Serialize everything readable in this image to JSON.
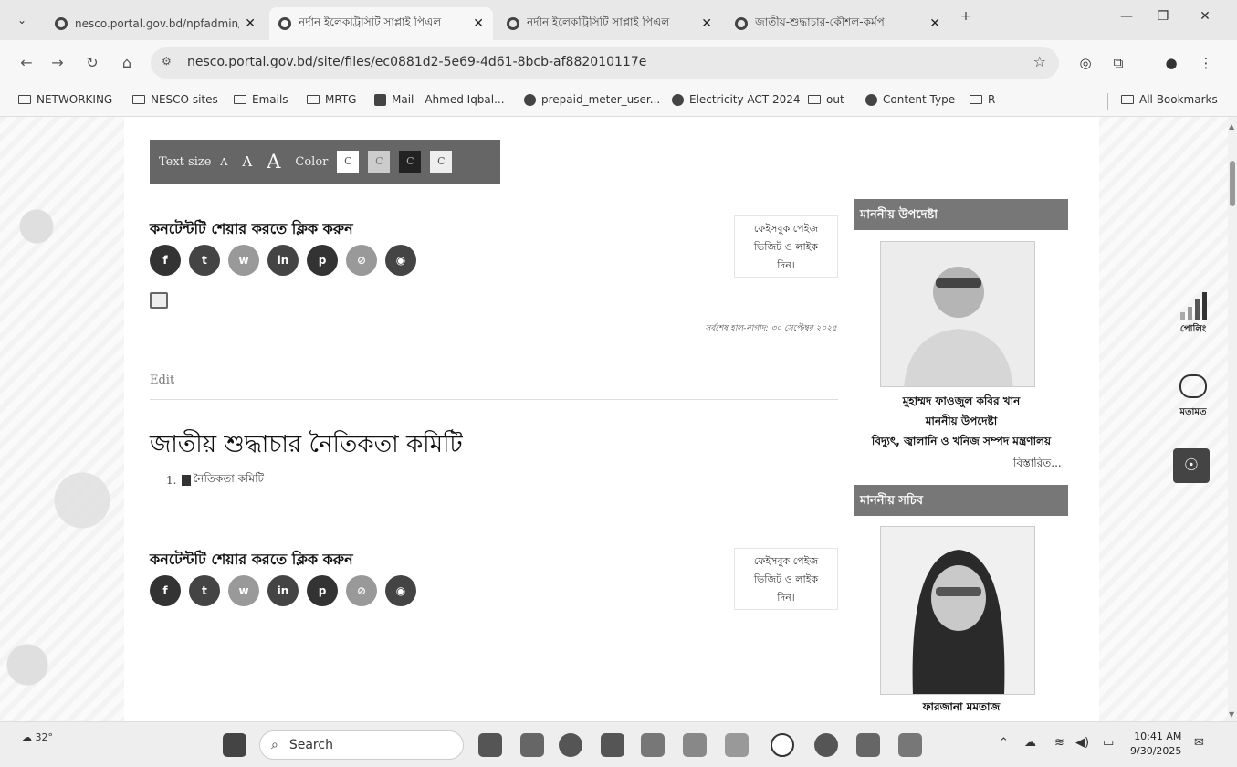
{
  "browser": {
    "tabs": [
      {
        "label": "nesco.portal.gov.bd/npfadmin/"
      },
      {
        "label": "নর্দান ইলেকট্রিসিটি সাপ্লাই পিএল"
      },
      {
        "label": "নর্দান ইলেকট্রিসিটি সাপ্লাই পিএল"
      },
      {
        "label": "জাতীয়-শুদ্ধাচার-কৌশল-কর্মপ"
      }
    ],
    "url": "nesco.portal.gov.bd/site/files/ec0881d2-5e69-4d61-8bcb-af882010117e",
    "bookmarks": [
      "NETWORKING",
      "NESCO sites",
      "Emails",
      "MRTG",
      "Mail - Ahmed Iqbal...",
      "prepaid_meter_user...",
      "Electricity ACT 2024",
      "out",
      "Content Type",
      "R",
      "All Bookmarks"
    ]
  },
  "accessibility": {
    "text_size_label": "Text size",
    "size_small": "A",
    "size_medium": "A",
    "size_large": "A",
    "color_label": "Color",
    "color_options": [
      "C",
      "C",
      "C",
      "C"
    ]
  },
  "share": {
    "title": "কনটেন্টটি শেয়ার করতে ক্লিক করুন",
    "fb_box": [
      "ফেইসবুক পেইজ",
      "ভিজিট ও লাইক",
      "দিন।"
    ]
  },
  "updated_text": "সর্বশেষ হাল-নাগাদ: ৩০ সেপ্টেম্বর ২০২৫",
  "edit_label": "Edit",
  "heading": "জাতীয় শুদ্ধাচার নৈতিকতা কমিটি",
  "documents": [
    {
      "num": "1.",
      "label": "নৈতিকতা কমিটি"
    }
  ],
  "sidebar": {
    "adviser_header": "মাননীয় উপদেষ্টা",
    "adviser_name": "মুহাম্মদ ফাওজুল কবির খান",
    "adviser_title": "মাননীয় উপদেষ্টা",
    "adviser_ministry": "বিদ্যুৎ, জ্বালানি ও খনিজ সম্পদ মন্ত্রণালয়",
    "more": "বিস্তারিত...",
    "secretary_header": "মাননীয় সচিব",
    "secretary_name": "ফারজানা মমতাজ"
  },
  "floating": {
    "poll": "পোলিং",
    "opinion": "মতামত"
  },
  "taskbar": {
    "weather": "32°",
    "search": "Search",
    "time": "10:41 AM",
    "date": "9/30/2025"
  }
}
